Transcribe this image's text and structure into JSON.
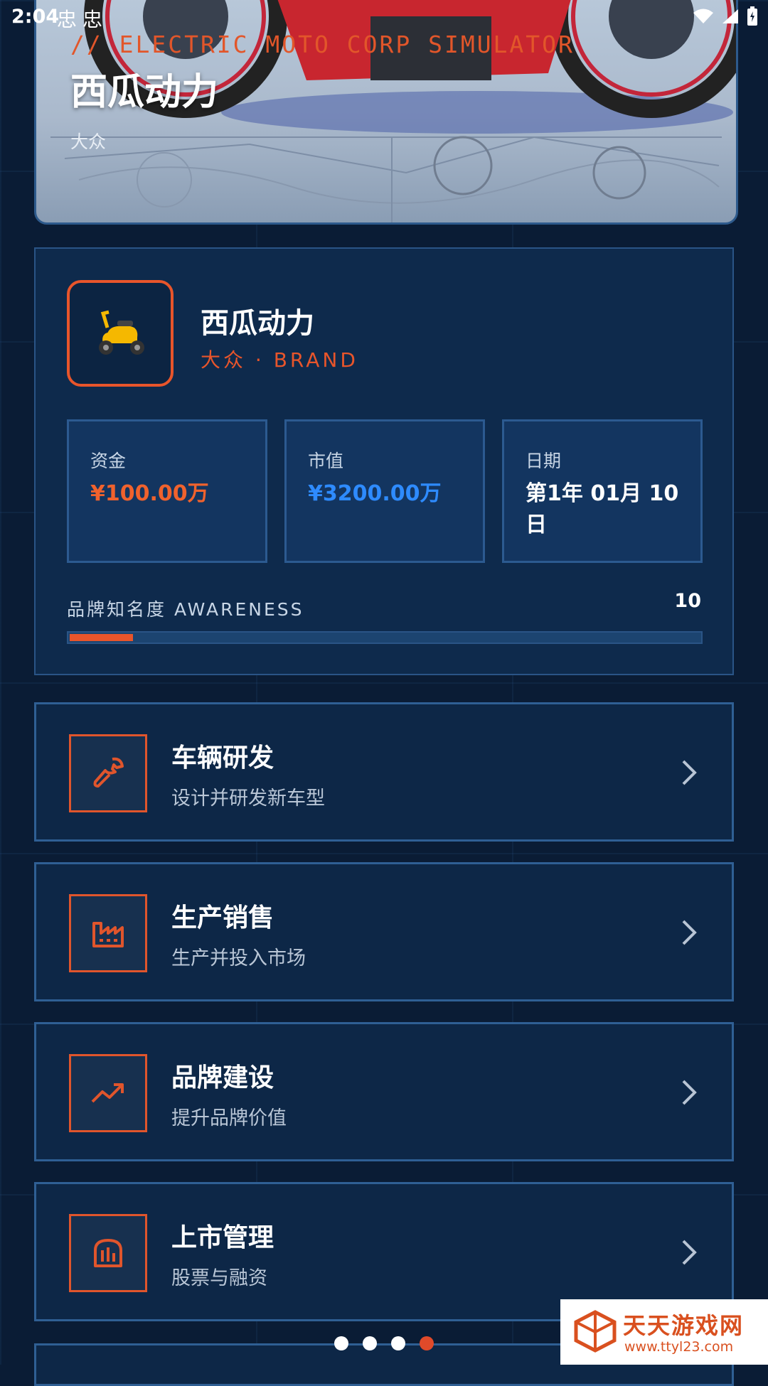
{
  "status_bar": {
    "time": "2:04",
    "bug_icons": [
      "忠",
      "忠"
    ]
  },
  "hero": {
    "tagline": "// ELECTRIC MOTO CORP SIMULATOR",
    "title": "西瓜动力",
    "subtitle": "大众"
  },
  "company": {
    "name": "西瓜动力",
    "brand": "大众 · BRAND",
    "logo_icon": "scooter-icon",
    "stats": [
      {
        "label": "资金",
        "value": "¥100.00万",
        "color": "#f0622d"
      },
      {
        "label": "市值",
        "value": "¥3200.00万",
        "color": "#2e8bff"
      },
      {
        "label": "日期",
        "value": "第1年  01月 10日",
        "color": "#ffffff"
      }
    ],
    "awareness": {
      "label": "品牌知名度 AWARENESS",
      "value": "10",
      "fraction": 0.1
    }
  },
  "menu": [
    {
      "title": "车辆研发",
      "subtitle": "设计并研发新车型",
      "icon": "wrench-icon"
    },
    {
      "title": "生产销售",
      "subtitle": "生产并投入市场",
      "icon": "factory-icon"
    },
    {
      "title": "品牌建设",
      "subtitle": "提升品牌价值",
      "icon": "trending-up-icon"
    },
    {
      "title": "上市管理",
      "subtitle": "股票与融资",
      "icon": "stock-exchange-icon"
    }
  ],
  "pager": {
    "count": 4,
    "active": 3
  },
  "watermark": {
    "name": "天天游戏网",
    "url": "www.ttyl23.com"
  },
  "colors": {
    "accent": "#e8552b",
    "background": "#0a1c35",
    "card": "#0e2a4c",
    "market_value": "#2e8bff"
  }
}
